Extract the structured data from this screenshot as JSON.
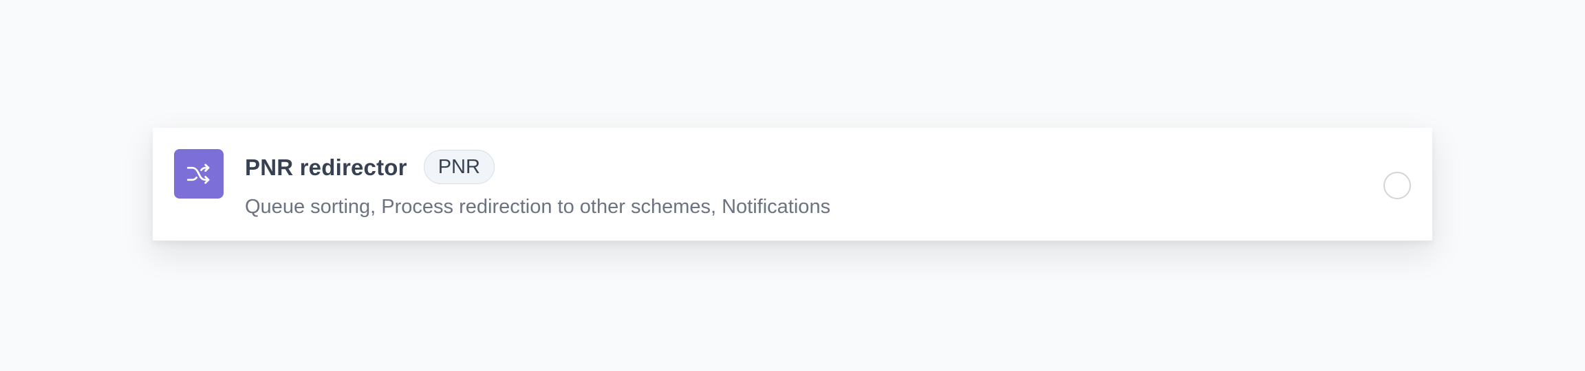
{
  "option": {
    "icon": "shuffle-icon",
    "icon_color": "#7c6fd8",
    "title": "PNR redirector",
    "badge": "PNR",
    "description": "Queue sorting, Process redirection to other schemes, Notifications",
    "selected": false
  }
}
